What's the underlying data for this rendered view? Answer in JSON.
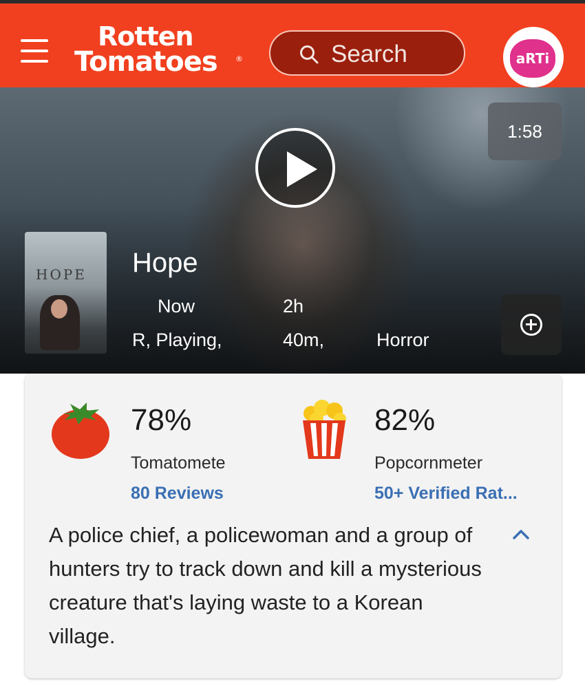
{
  "header": {
    "logo_line1": "Rotten",
    "logo_line2": "Tomatoes",
    "logo_reg": "®",
    "search_placeholder": "Search",
    "avatar_text": "aRTi"
  },
  "hero": {
    "duration": "1:58"
  },
  "movie": {
    "poster_text": "HOPE",
    "title": "Hope",
    "rating_status_line1": "Now",
    "rating_status_line2": "R, Playing,",
    "runtime_line1": "2h",
    "runtime_line2": "40m,",
    "genre": "Horror"
  },
  "scores": {
    "tomatometer": {
      "percent": "78%",
      "label": "Tomatomete",
      "reviews_link": "80 Reviews"
    },
    "popcornmeter": {
      "percent": "82%",
      "label": "Popcornmeter",
      "ratings_link": "50+ Verified Rat..."
    }
  },
  "synopsis": "A police chief, a policewoman and a group of hunters try to track down and kill a mysterious creature that's laying waste to a Korean village.",
  "colors": {
    "brand_red": "#f1401f",
    "link_blue": "#3a6fb3",
    "tomato_red": "#e3381c",
    "stem_green": "#3a8a2a"
  },
  "icons": [
    "menu-icon",
    "search-icon",
    "play-icon",
    "add-icon",
    "tomato-icon",
    "popcorn-icon",
    "chevron-up-icon"
  ]
}
